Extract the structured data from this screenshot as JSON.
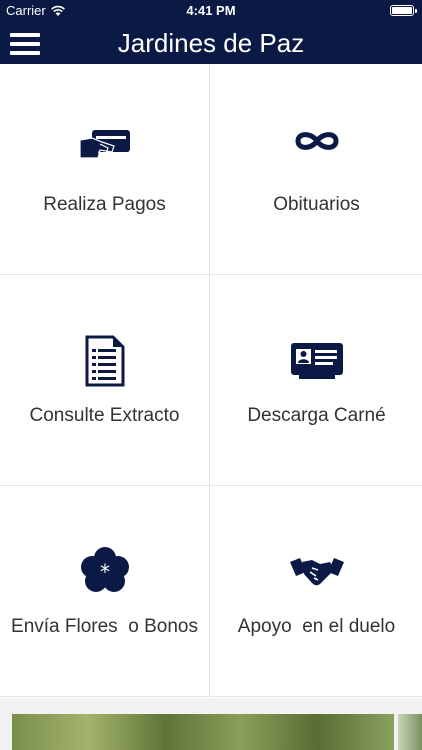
{
  "status_bar": {
    "carrier": "Carrier",
    "time": "4:41 PM"
  },
  "header": {
    "title": "Jardines de Paz",
    "menu_icon": "hamburger-menu-icon"
  },
  "tiles": [
    {
      "label": "Realiza Pagos",
      "icon": "card-payment-icon"
    },
    {
      "label": "Obituarios",
      "icon": "infinity-icon"
    },
    {
      "label": "Consulte Extracto",
      "icon": "document-icon"
    },
    {
      "label": "Descarga Carné",
      "icon": "id-card-icon"
    },
    {
      "label": "Envía Flores  o Bonos",
      "icon": "flower-icon"
    },
    {
      "label": "Apoyo  en el duelo",
      "icon": "handshake-icon"
    }
  ],
  "colors": {
    "navbar": "#0b1a44",
    "icon": "#0b1a44",
    "label": "#333333"
  }
}
